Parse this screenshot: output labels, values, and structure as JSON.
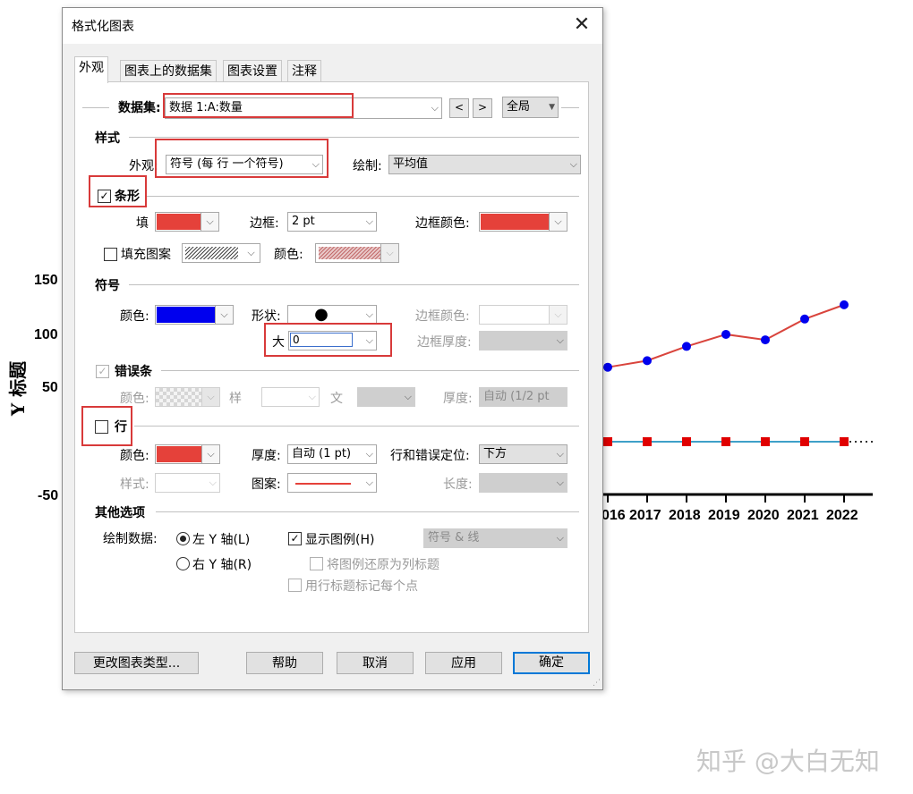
{
  "chart": {
    "y_title": "Y 标题",
    "y_ticks": [
      "150",
      "100",
      "50",
      "-50"
    ],
    "x_ticks": [
      "2016",
      "2017",
      "2018",
      "2019",
      "2020",
      "2021",
      "2022"
    ],
    "x_tick_first_visible": "016",
    "line_color": "#d9443c",
    "marker_blue": "#0000ee",
    "marker_red": "#e00000"
  },
  "chart_data": {
    "type": "line",
    "x": [
      2016,
      2017,
      2018,
      2019,
      2020,
      2021,
      2022
    ],
    "series": [
      {
        "values": [
          68,
          74,
          87,
          98,
          93,
          112,
          125
        ],
        "color": "#d9443c",
        "marker": "circle",
        "marker_color": "#0000ee"
      },
      {
        "values": [
          0,
          0,
          0,
          0,
          0,
          0,
          0
        ],
        "color": "#3fa0c8",
        "marker": "square",
        "marker_color": "#e00000"
      }
    ],
    "ylabel": "Y 标题",
    "yticks": [
      150,
      100,
      50,
      -50
    ]
  },
  "watermark": "知乎 @大白无知",
  "dialog": {
    "title": "格式化图表",
    "close": "✕",
    "tabs": [
      "外观",
      "图表上的数据集",
      "图表设置",
      "注释"
    ],
    "dataset": {
      "label": "数据集:",
      "value": "数据 1:A:数量",
      "prev": "<",
      "next": ">",
      "scope": "全局"
    },
    "style": {
      "section": "样式",
      "appearance_label": "外观:",
      "appearance_value": "符号 (每 行 一个符号)",
      "plot_label": "绘制:",
      "plot_value": "平均值"
    },
    "bar": {
      "label": "条形",
      "checked": "✓",
      "fill_label": "填",
      "fill_color": "#e5413a",
      "border_label": "边框:",
      "border_value": "2 pt",
      "border_color_label": "边框颜色:",
      "border_color": "#e5413a",
      "pattern_label": "填充图案",
      "pattern_color_label": "颜色:"
    },
    "symbol": {
      "section": "符号",
      "color_label": "颜色:",
      "color": "#0000ee",
      "shape_label": "形状:",
      "shape_value": "●",
      "size_label": "大",
      "size_value": "0",
      "border_color_label": "边框颜色:",
      "border_thickness_label": "边框厚度:"
    },
    "error_bar": {
      "label": "错误条",
      "checked": "✓",
      "color_label": "颜色:",
      "style_label": "样",
      "text_label": "文",
      "thickness_label": "厚度:",
      "thickness_value": "自动 (1/2 pt"
    },
    "row": {
      "label": "行",
      "color_label": "颜色:",
      "color": "#e5413a",
      "thickness_label": "厚度:",
      "thickness_value": "自动 (1 pt)",
      "position_label": "行和错误定位:",
      "position_value": "下方",
      "style_label": "样式:",
      "pattern_label": "图案:",
      "length_label": "长度:"
    },
    "other": {
      "section": "其他选项",
      "plot_data_label": "绘制数据:",
      "left_axis": "左 Y 轴(L)",
      "right_axis": "右 Y 轴(R)",
      "show_legend": "显示图例(H)",
      "show_legend_checked": "✓",
      "legend_mode": "符号 & 线",
      "restore_legend": "将图例还原为列标题",
      "row_title": "用行标题标记每个点"
    },
    "buttons": {
      "change_type": "更改图表类型...",
      "help": "帮助",
      "cancel": "取消",
      "apply": "应用",
      "ok": "确定"
    },
    "arrow_glyph": "⌵"
  }
}
